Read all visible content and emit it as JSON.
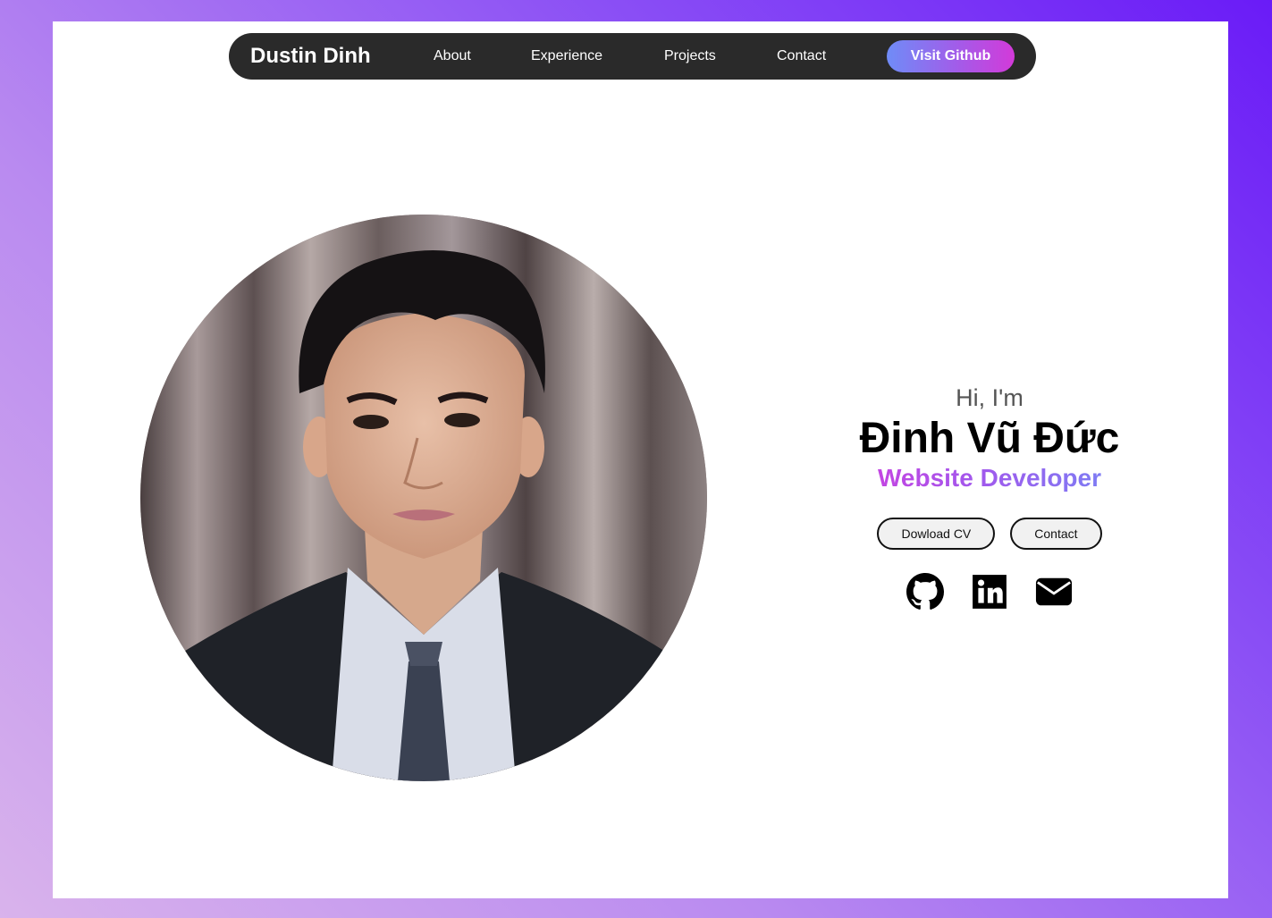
{
  "nav": {
    "brand": "Dustin Dinh",
    "links": [
      "About",
      "Experience",
      "Projects",
      "Contact"
    ],
    "cta": "Visit Github"
  },
  "hero": {
    "greeting": "Hi, I'm",
    "name": "Đinh Vũ Đức",
    "role": "Website Developer",
    "buttons": [
      "Dowload CV",
      "Contact"
    ],
    "socials": [
      "github-icon",
      "linkedin-icon",
      "email-icon"
    ]
  },
  "colors": {
    "nav_bg": "#2a2a2a",
    "accent_start": "#6f8cf7",
    "accent_end": "#d33ad9",
    "page_bg": "#ffffff"
  }
}
